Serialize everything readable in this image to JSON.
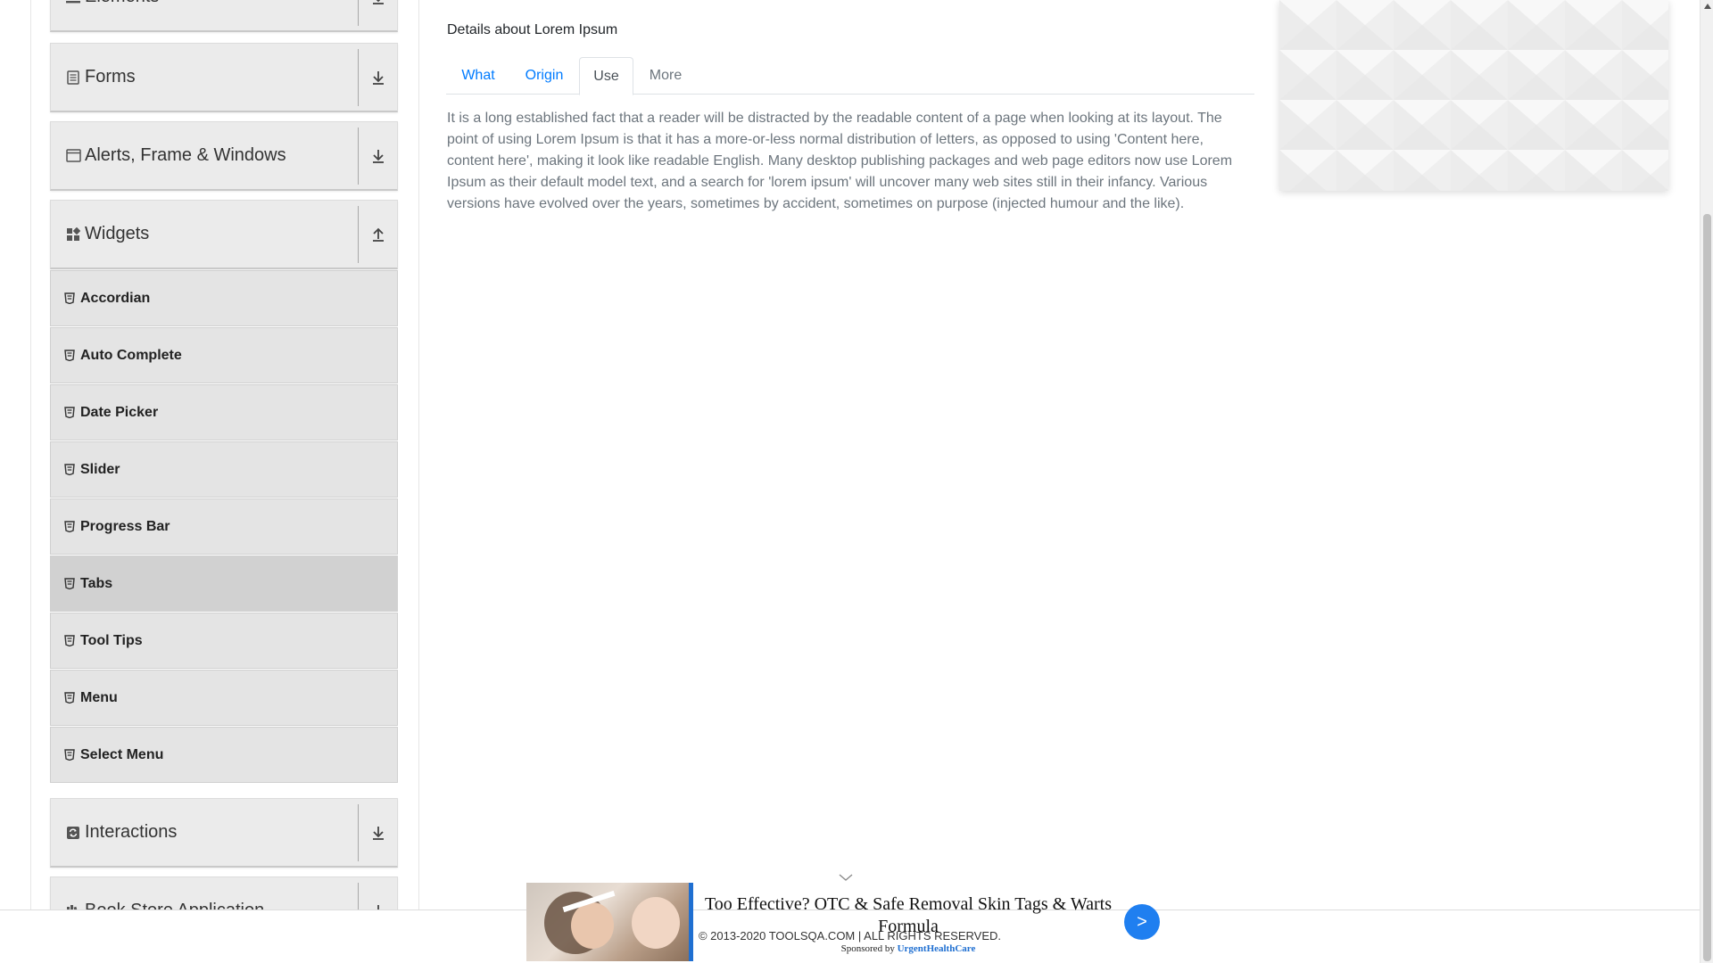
{
  "sidebar": {
    "groups": {
      "elements": {
        "label": "Elements",
        "icon": "hamburger-icon",
        "toggle": "download-arrow-icon"
      },
      "forms": {
        "label": "Forms",
        "icon": "document-icon",
        "toggle": "download-arrow-icon"
      },
      "alerts": {
        "label": "Alerts, Frame & Windows",
        "icon": "window-icon",
        "toggle": "download-arrow-icon"
      },
      "widgets": {
        "label": "Widgets",
        "icon": "widgets-grid-icon",
        "toggle": "upload-arrow-icon",
        "expanded": true
      },
      "interactions": {
        "label": "Interactions",
        "icon": "refresh-icon",
        "toggle": "download-arrow-icon"
      },
      "bookstore": {
        "label": "Book Store Application",
        "icon": "book-icon",
        "toggle": "download-arrow-icon"
      }
    },
    "widget_items": [
      {
        "label": "Accordian"
      },
      {
        "label": "Auto Complete"
      },
      {
        "label": "Date Picker"
      },
      {
        "label": "Slider"
      },
      {
        "label": "Progress Bar"
      },
      {
        "label": "Tabs",
        "active": true
      },
      {
        "label": "Tool Tips"
      },
      {
        "label": "Menu"
      },
      {
        "label": "Select Menu"
      }
    ]
  },
  "main": {
    "title": "Details about Lorem Ipsum",
    "tabs": [
      {
        "label": "What"
      },
      {
        "label": "Origin"
      },
      {
        "label": "Use",
        "active": true
      },
      {
        "label": "More",
        "disabled": true
      }
    ],
    "content": "It is a long established fact that a reader will be distracted by the readable content of a page when looking at its layout. The point of using Lorem Ipsum is that it has a more-or-less normal distribution of letters, as opposed to using 'Content here, content here', making it look like readable English. Many desktop publishing packages and web page editors now use Lorem Ipsum as their default model text, and a search for 'lorem ipsum' will uncover many web sites still in their infancy. Various versions have evolved over the years, sometimes by accident, sometimes on purpose (injected humour and the like)."
  },
  "footer": {
    "copyright": "© 2013-2020 TOOLSQA.COM | ALL RIGHTS RESERVED."
  },
  "ad": {
    "headline": "Too Effective? OTC & Safe Removal Skin Tags & Warts Formula",
    "sponsored_prefix": "Sponsored by",
    "sponsor": "UrgentHealthCare",
    "next_label": ">"
  },
  "colors": {
    "link": "#007bff",
    "ad_accent": "#1f7ff0",
    "sidebar_bg": "#ebebeb",
    "active_item_bg": "#d1d1d1"
  }
}
